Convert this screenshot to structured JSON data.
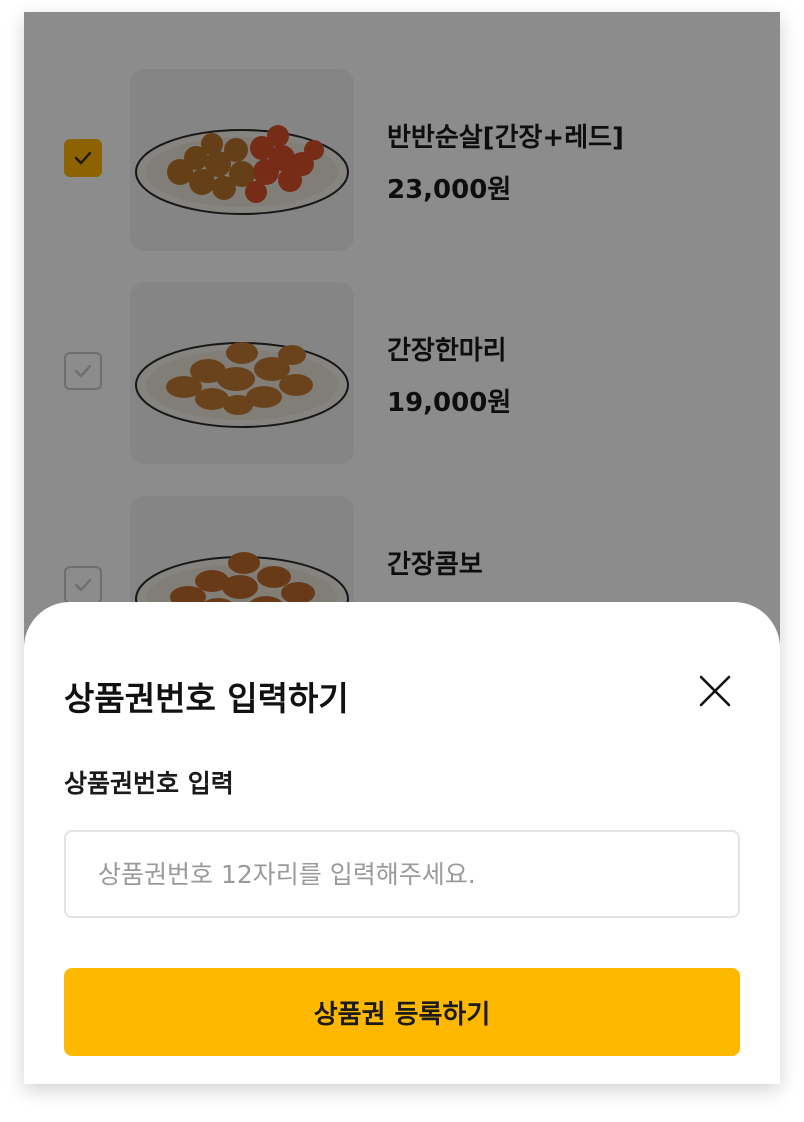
{
  "products": [
    {
      "name": "반반순살[간장+레드]",
      "price": "23,000원",
      "checked": true,
      "image_icon": "chicken-platter-image"
    },
    {
      "name": "간장한마리",
      "price": "19,000원",
      "checked": false,
      "image_icon": "chicken-platter-image"
    },
    {
      "name": "간장콤보",
      "price": "",
      "checked": false,
      "image_icon": "chicken-platter-image"
    }
  ],
  "sheet": {
    "title": "상품권번호 입력하기",
    "close_icon": "close-icon",
    "field_label": "상품권번호 입력",
    "input_value": "",
    "input_placeholder": "상품권번호 12자리를 입력해주세요.",
    "submit_label": "상품권 등록하기"
  },
  "colors": {
    "accent": "#FFB800",
    "checkbox_checked": "#FFB400",
    "overlay": "rgba(0,0,0,0.45)"
  }
}
